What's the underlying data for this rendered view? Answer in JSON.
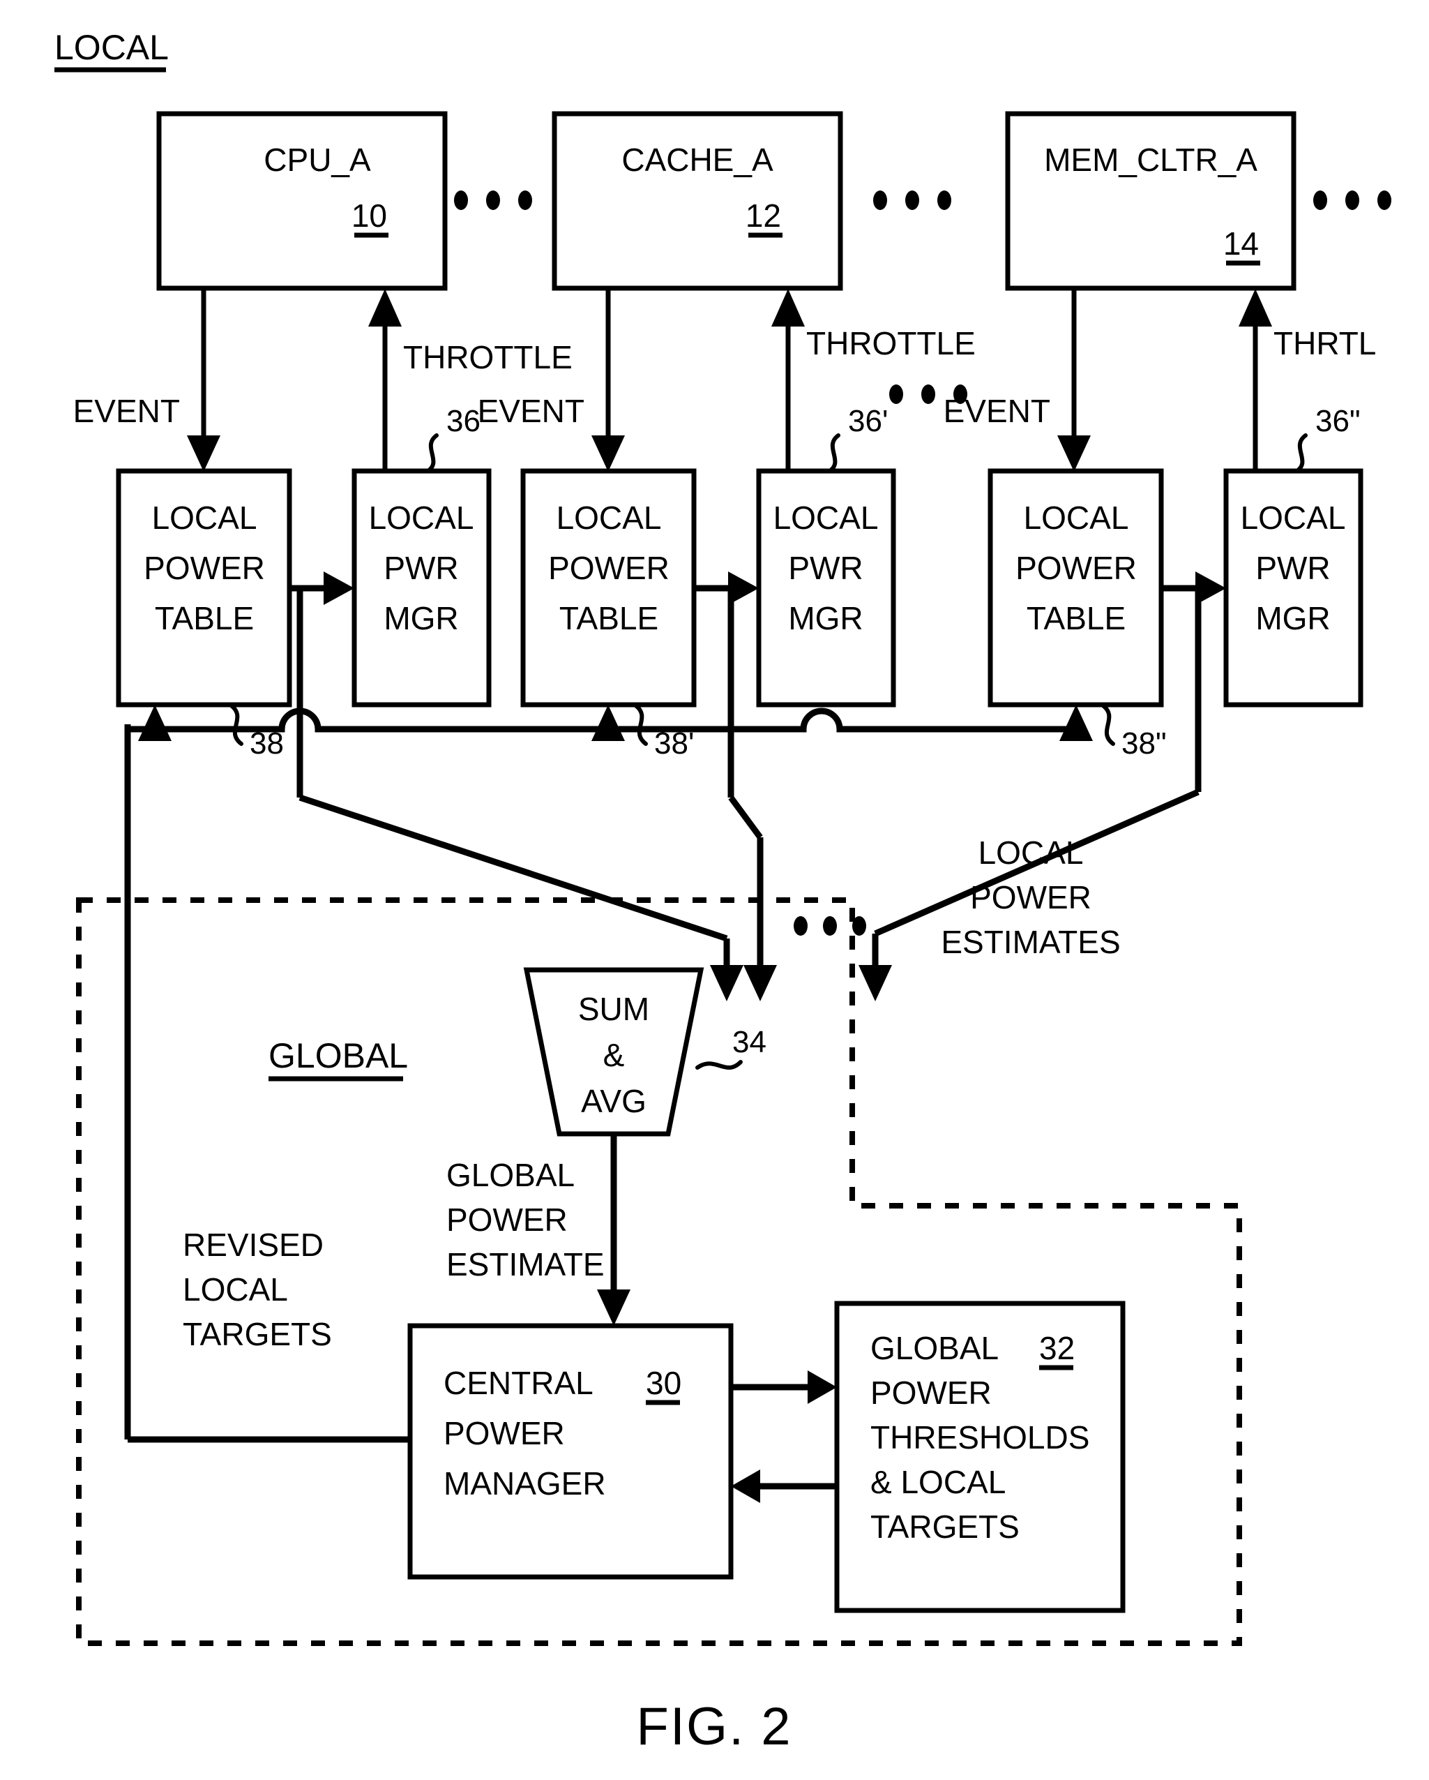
{
  "figure": {
    "caption": "FIG. 2",
    "section_labels": {
      "local": "LOCAL",
      "global": "GLOBAL"
    }
  },
  "top_blocks": [
    {
      "name": "CPU_A",
      "ref": "10"
    },
    {
      "name": "CACHE_A",
      "ref": "12"
    },
    {
      "name": "MEM_CLTR_A",
      "ref": "14"
    }
  ],
  "ellipses": {
    "glyph": "•",
    "count": 3
  },
  "signal_labels": {
    "event_1": "EVENT",
    "throttle_1": "THROTTLE",
    "event_2": "EVENT",
    "throttle_2": "THROTTLE",
    "event_3": "EVENT",
    "throttle_3": "THRTL"
  },
  "local_groups": [
    {
      "table_lines": [
        "LOCAL",
        "POWER",
        "TABLE"
      ],
      "table_ref": "38",
      "mgr_lines": [
        "LOCAL",
        "PWR",
        "MGR"
      ],
      "mgr_ref": "36"
    },
    {
      "table_lines": [
        "LOCAL",
        "POWER",
        "TABLE"
      ],
      "table_ref": "38'",
      "mgr_lines": [
        "LOCAL",
        "PWR",
        "MGR"
      ],
      "mgr_ref": "36'"
    },
    {
      "table_lines": [
        "LOCAL",
        "POWER",
        "TABLE"
      ],
      "table_ref": "38\"",
      "mgr_lines": [
        "LOCAL",
        "PWR",
        "MGR"
      ],
      "mgr_ref": "36\""
    }
  ],
  "bus_labels": {
    "local_power_estimates": [
      "LOCAL",
      "POWER",
      "ESTIMATES"
    ],
    "global_power_estimate": [
      "GLOBAL",
      "POWER",
      "ESTIMATE"
    ],
    "revised_local_targets": [
      "REVISED",
      "LOCAL",
      "TARGETS"
    ]
  },
  "summer": {
    "lines": [
      "SUM",
      "&",
      "AVG"
    ],
    "ref": "34"
  },
  "central_manager": {
    "lines": [
      "CENTRAL",
      "POWER",
      "MANAGER"
    ],
    "ref": "30"
  },
  "thresholds_block": {
    "lines": [
      "GLOBAL",
      "POWER",
      "THRESHOLDS",
      "& LOCAL",
      "TARGETS"
    ],
    "ref": "32"
  },
  "colors": {
    "ink": "#000000",
    "paper": "#ffffff"
  }
}
